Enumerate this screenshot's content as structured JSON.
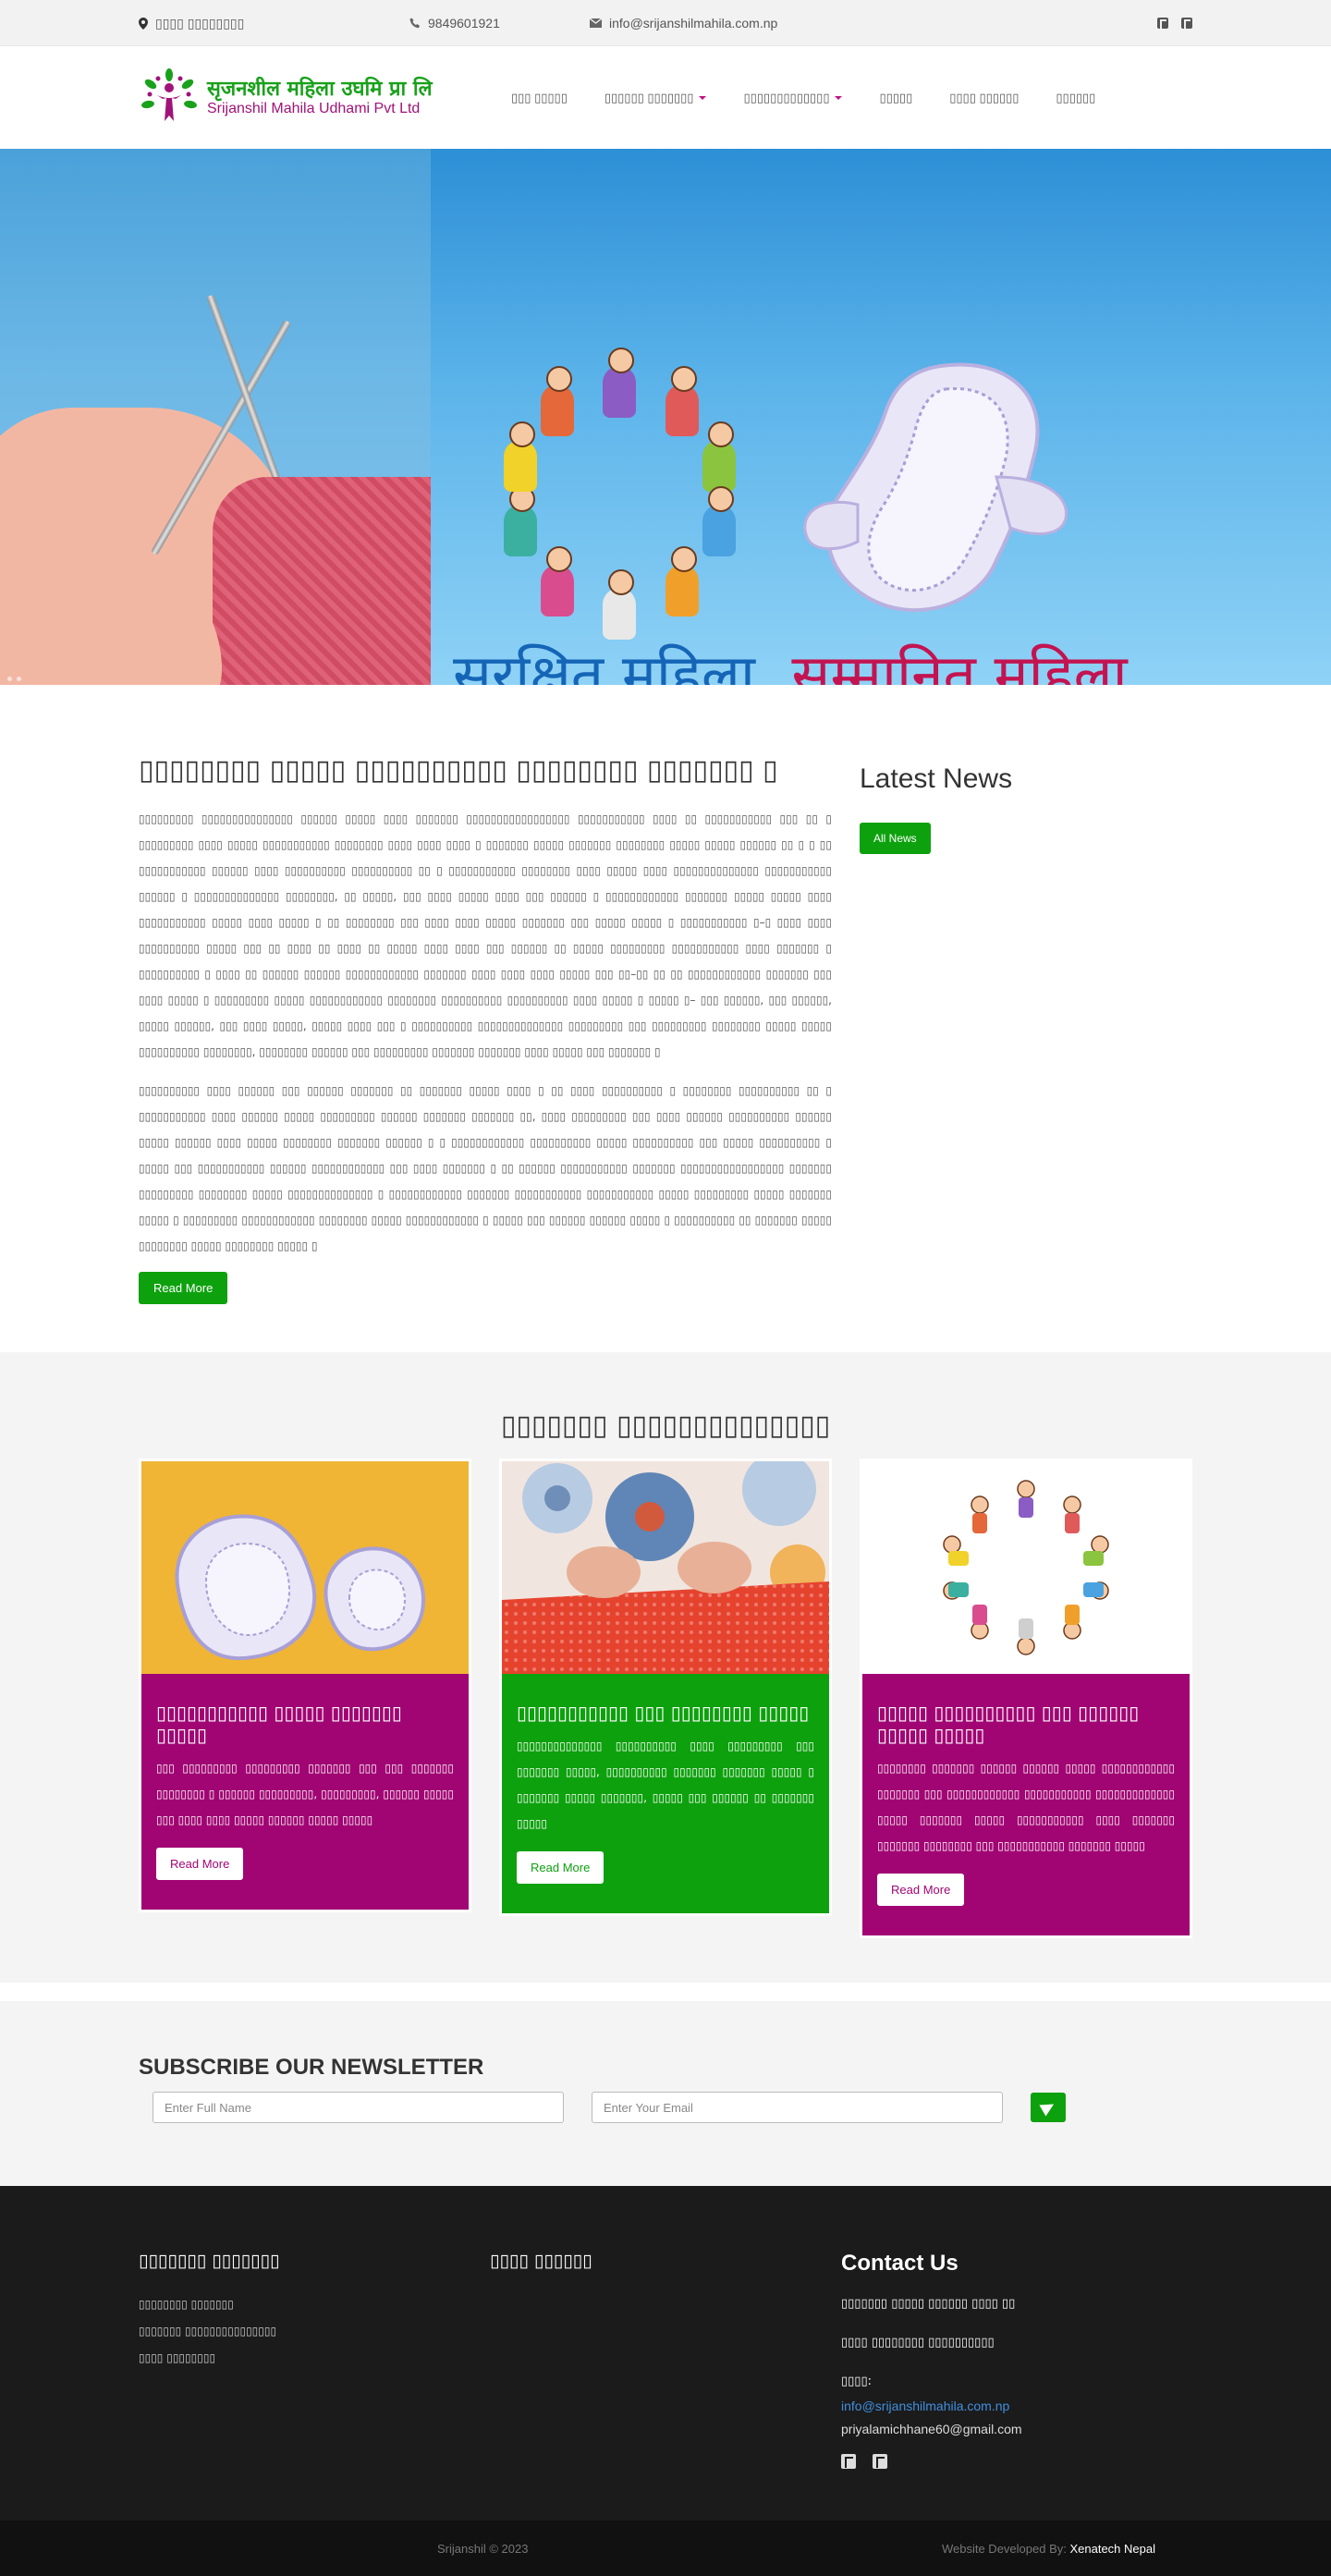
{
  "topbar": {
    "address": "▯▯▯▯ ▯▯▯▯▯▯▯▯",
    "phone": "9849601921",
    "email": "info@srijanshilmahila.com.np"
  },
  "brand": {
    "name_np": "सृजनशील महिला उघमि प्रा लि",
    "name_en": "Srijanshil Mahila Udhami Pvt Ltd"
  },
  "nav": {
    "items": [
      {
        "label": "▯▯▯ ▯▯▯▯▯"
      },
      {
        "label": "▯▯▯▯▯▯ ▯▯▯▯▯▯▯"
      },
      {
        "label": "▯▯▯▯▯▯▯▯▯▯▯▯▯"
      },
      {
        "label": "▯▯▯▯▯"
      },
      {
        "label": "▯▯▯▯ ▯▯▯▯▯▯"
      },
      {
        "label": "▯▯▯▯▯▯"
      }
    ]
  },
  "hero": {
    "tagline_part1": "सुरक्षित महिला,",
    "tagline_part2": "सम्मानित महिला"
  },
  "intro": {
    "heading": "▯▯▯▯▯▯▯▯ ▯▯▯▯▯ ▯▯▯▯▯▯▯▯▯▯ ▯▯▯▯▯▯▯▯ ▯▯▯▯▯▯▯ ▯",
    "paragraph1": "▯▯▯▯▯▯▯▯▯ ▯▯▯▯▯▯▯▯▯▯▯▯▯▯▯ ▯▯▯▯▯▯ ▯▯▯▯▯ ▯▯▯▯ ▯▯▯▯▯▯▯ ▯▯▯▯▯▯▯▯▯▯▯▯▯▯▯▯▯ ▯▯▯▯▯▯▯▯▯▯▯ ▯▯▯▯ ▯▯ ▯▯▯▯▯▯▯▯▯▯▯ ▯▯▯ ▯▯ ▯ ▯▯▯▯▯▯▯▯▯ ▯▯▯▯ ▯▯▯▯▯ ▯▯▯▯▯▯▯▯▯▯▯ ▯▯▯▯▯▯▯▯ ▯▯▯▯ ▯▯▯▯ ▯▯▯▯ ▯ ▯▯▯▯▯▯▯ ▯▯▯▯▯ ▯▯▯▯▯▯▯ ▯▯▯▯▯▯▯▯ ▯▯▯▯▯ ▯▯▯▯▯ ▯▯▯▯▯▯ ▯▯ ▯ ▯ ▯▯ ▯▯▯▯▯▯▯▯▯▯▯ ▯▯▯▯▯▯ ▯▯▯▯ ▯▯▯▯▯▯▯▯▯▯ ▯▯▯▯▯▯▯▯▯▯ ▯▯ ▯ ▯▯▯▯▯▯▯▯▯▯▯ ▯▯▯▯▯▯▯▯ ▯▯▯▯ ▯▯▯▯▯ ▯▯▯▯ ▯▯▯▯▯▯▯▯▯▯▯▯▯▯ ▯▯▯▯▯▯▯▯▯▯▯ ▯▯▯▯▯▯ ▯ ▯▯▯▯▯▯▯▯▯▯▯▯▯▯ ▯▯▯▯▯▯▯▯, ▯▯ ▯▯▯▯▯, ▯▯▯ ▯▯▯▯ ▯▯▯▯▯ ▯▯▯▯ ▯▯▯ ▯▯▯▯▯▯ ▯ ▯▯▯▯▯▯▯▯▯▯▯▯ ▯▯▯▯▯▯▯ ▯▯▯▯▯ ▯▯▯▯▯ ▯▯▯▯ ▯▯▯▯▯▯▯▯▯▯▯ ▯▯▯▯▯ ▯▯▯▯ ▯▯▯▯▯ ▯ ▯▯ ▯▯▯▯▯▯▯▯ ▯▯▯ ▯▯▯▯ ▯▯▯▯ ▯▯▯▯▯ ▯▯▯▯▯▯▯ ▯▯▯ ▯▯▯▯▯ ▯▯▯▯▯ ▯ ▯▯▯▯▯▯▯▯▯▯▯ ▯–▯ ▯▯▯▯ ▯▯▯▯ ▯▯▯▯▯▯▯▯▯▯ ▯▯▯▯▯ ▯▯▯ ▯▯ ▯▯▯▯ ▯▯ ▯▯▯▯ ▯▯ ▯▯▯▯▯ ▯▯▯▯ ▯▯▯▯ ▯▯▯ ▯▯▯▯▯▯ ▯▯ ▯▯▯▯▯ ▯▯▯▯▯▯▯▯▯ ▯▯▯▯▯▯▯▯▯▯▯ ▯▯▯▯ ▯▯▯▯▯▯▯ ▯ ▯▯▯▯▯▯▯▯▯▯ ▯ ▯▯▯▯ ▯▯ ▯▯▯▯▯▯ ▯▯▯▯▯▯ ▯▯▯▯▯▯▯▯▯▯▯▯ ▯▯▯▯▯▯▯ ▯▯▯▯ ▯▯▯▯ ▯▯▯▯ ▯▯▯▯▯ ▯▯▯ ▯▯–▯▯ ▯▯ ▯▯ ▯▯▯▯▯▯▯▯▯▯▯▯ ▯▯▯▯▯▯▯ ▯▯▯ ▯▯▯▯ ▯▯▯▯▯ ▯ ▯▯▯▯▯▯▯▯▯ ▯▯▯▯▯ ▯▯▯▯▯▯▯▯▯▯▯▯ ▯▯▯▯▯▯▯▯ ▯▯▯▯▯▯▯▯▯▯ ▯▯▯▯▯▯▯▯▯▯ ▯▯▯▯ ▯▯▯▯▯ ▯ ▯▯▯▯▯ ▯– ▯▯▯ ▯▯▯▯▯▯, ▯▯▯ ▯▯▯▯▯▯, ▯▯▯▯▯ ▯▯▯▯▯▯, ▯▯▯ ▯▯▯▯ ▯▯▯▯▯, ▯▯▯▯▯ ▯▯▯▯ ▯▯▯ ▯ ▯▯▯▯▯▯▯▯▯▯ ▯▯▯▯▯▯▯▯▯▯▯▯▯▯ ▯▯▯▯▯▯▯▯▯ ▯▯▯ ▯▯▯▯▯▯▯▯▯ ▯▯▯▯▯▯▯▯ ▯▯▯▯▯ ▯▯▯▯▯ ▯▯▯▯▯▯▯▯▯▯ ▯▯▯▯▯▯▯▯, ▯▯▯▯▯▯▯▯ ▯▯▯▯▯▯ ▯▯▯ ▯▯▯▯▯▯▯▯▯ ▯▯▯▯▯▯▯ ▯▯▯▯▯▯▯ ▯▯▯▯ ▯▯▯▯▯ ▯▯▯ ▯▯▯▯▯▯▯ ▯",
    "paragraph2": "▯▯▯▯▯▯▯▯▯▯ ▯▯▯▯ ▯▯▯▯▯▯ ▯▯▯ ▯▯▯▯▯▯ ▯▯▯▯▯▯▯ ▯▯ ▯▯▯▯▯▯▯ ▯▯▯▯▯ ▯▯▯▯ ▯ ▯▯ ▯▯▯▯ ▯▯▯▯▯▯▯▯▯▯ ▯ ▯▯▯▯▯▯▯▯ ▯▯▯▯▯▯▯▯▯▯ ▯▯ ▯ ▯▯▯▯▯▯▯▯▯▯▯ ▯▯▯▯ ▯▯▯▯▯▯ ▯▯▯▯▯ ▯▯▯▯▯▯▯▯▯ ▯▯▯▯▯▯ ▯▯▯▯▯▯▯ ▯▯▯▯▯▯▯ ▯▯, ▯▯▯▯ ▯▯▯▯▯▯▯▯▯ ▯▯▯ ▯▯▯▯ ▯▯▯▯▯▯ ▯▯▯▯▯▯▯▯▯▯ ▯▯▯▯▯▯ ▯▯▯▯▯ ▯▯▯▯▯▯ ▯▯▯▯ ▯▯▯▯▯ ▯▯▯▯▯▯▯▯ ▯▯▯▯▯▯▯ ▯▯▯▯▯▯ ▯ ▯ ▯▯▯▯▯▯▯▯▯▯▯▯ ▯▯▯▯▯▯▯▯▯▯ ▯▯▯▯▯ ▯▯▯▯▯▯▯▯▯▯ ▯▯▯ ▯▯▯▯▯ ▯▯▯▯▯▯▯▯▯▯ ▯ ▯▯▯▯▯ ▯▯▯ ▯▯▯▯▯▯▯▯▯▯▯ ▯▯▯▯▯▯ ▯▯▯▯▯▯▯▯▯▯▯▯ ▯▯▯ ▯▯▯▯ ▯▯▯▯▯▯▯ ▯ ▯▯ ▯▯▯▯▯▯ ▯▯▯▯▯▯▯▯▯▯▯ ▯▯▯▯▯▯▯ ▯▯▯▯▯▯▯▯▯▯▯▯▯▯▯▯▯ ▯▯▯▯▯▯▯ ▯▯▯▯▯▯▯▯▯ ▯▯▯▯▯▯▯▯ ▯▯▯▯▯ ▯▯▯▯▯▯▯▯▯▯▯▯▯▯ ▯ ▯▯▯▯▯▯▯▯▯▯▯▯ ▯▯▯▯▯▯▯ ▯▯▯▯▯▯▯▯▯▯▯ ▯▯▯▯▯▯▯▯▯▯▯ ▯▯▯▯▯ ▯▯▯▯▯▯▯▯▯ ▯▯▯▯▯ ▯▯▯▯▯▯▯ ▯▯▯▯▯ ▯ ▯▯▯▯▯▯▯▯▯ ▯▯▯▯▯▯▯▯▯▯▯▯ ▯▯▯▯▯▯▯▯ ▯▯▯▯▯ ▯▯▯▯▯▯▯▯▯▯▯▯ ▯ ▯▯▯▯▯ ▯▯▯ ▯▯▯▯▯▯ ▯▯▯▯▯▯ ▯▯▯▯▯ ▯ ▯▯▯▯▯▯▯▯▯▯ ▯▯ ▯▯▯▯▯▯▯ ▯▯▯▯▯ ▯▯▯▯▯▯▯▯ ▯▯▯▯▯ ▯▯▯▯▯▯▯▯ ▯▯▯▯▯ ▯",
    "read_more": "Read More"
  },
  "news": {
    "title": "Latest News",
    "all_news": "All News"
  },
  "services": {
    "title": "▯▯▯▯▯▯▯ ▯▯▯▯▯▯▯▯▯▯▯▯▯▯",
    "cards": [
      {
        "title": "▯▯▯▯▯▯▯▯▯▯▯ ▯▯▯▯▯ ▯▯▯▯▯▯▯ ▯▯▯▯▯",
        "text": "▯▯▯ ▯▯▯▯▯▯▯▯▯ ▯▯▯▯▯▯▯▯▯ ▯▯▯▯▯▯▯ ▯▯▯ ▯▯▯ ▯▯▯▯▯▯▯ ▯▯▯▯▯▯▯▯ ▯ ▯▯▯▯▯▯ ▯▯▯▯▯▯▯▯▯, ▯▯▯▯▯▯▯▯▯, ▯▯▯▯▯▯ ▯▯▯▯▯ ▯▯▯ ▯▯▯▯ ▯▯▯▯ ▯▯▯▯▯ ▯▯▯▯▯▯ ▯▯▯▯▯ ▯▯▯▯▯",
        "button": "Read More",
        "color": "#a10573"
      },
      {
        "title": "▯▯▯▯▯▯▯▯▯▯▯ ▯▯▯ ▯▯▯▯▯▯▯▯ ▯▯▯▯▯",
        "text": "▯▯▯▯▯▯▯▯▯▯▯▯▯▯ ▯▯▯▯▯▯▯▯▯▯ ▯▯▯▯ ▯▯▯▯▯▯▯▯▯ ▯▯▯ ▯▯▯▯▯▯▯ ▯▯▯▯▯, ▯▯▯▯▯▯▯▯▯▯ ▯▯▯▯▯▯▯ ▯▯▯▯▯▯▯ ▯▯▯▯▯ ▯ ▯▯▯▯▯▯▯ ▯▯▯▯▯ ▯▯▯▯▯▯▯, ▯▯▯▯▯ ▯▯▯ ▯▯▯▯▯▯ ▯▯ ▯▯▯▯▯▯▯ ▯▯▯▯▯",
        "button": "Read More",
        "color": "#0ea10e"
      },
      {
        "title": "▯▯▯▯▯ ▯▯▯▯▯▯▯▯▯▯ ▯▯▯ ▯▯▯▯▯▯ ▯▯▯▯▯ ▯▯▯▯▯",
        "text": "▯▯▯▯▯▯▯▯ ▯▯▯▯▯▯▯ ▯▯▯▯▯▯ ▯▯▯▯▯▯ ▯▯▯▯▯ ▯▯▯▯▯▯▯▯▯▯▯▯ ▯▯▯▯▯▯▯ ▯▯▯ ▯▯▯▯▯▯▯▯▯▯▯▯ ▯▯▯▯▯▯▯▯▯▯▯ ▯▯▯▯▯▯▯▯▯▯▯▯▯ ▯▯▯▯▯ ▯▯▯▯▯▯▯ ▯▯▯▯▯ ▯▯▯▯▯▯▯▯▯▯▯ ▯▯▯▯ ▯▯▯▯▯▯▯ ▯▯▯▯▯▯▯ ▯▯▯▯▯▯▯▯ ▯▯▯ ▯▯▯▯▯▯▯▯▯▯▯ ▯▯▯▯▯▯▯ ▯▯▯▯▯",
        "button": "Read More",
        "color": "#a10573"
      }
    ]
  },
  "newsletter": {
    "title": "SUBSCRIBE OUR NEWSLETTER",
    "name_placeholder": "Enter Full Name",
    "email_placeholder": "Enter Your Email"
  },
  "footer": {
    "col1_title": "▯▯▯▯▯▯▯ ▯▯▯▯▯▯▯",
    "col1_links": [
      "▯▯▯▯▯▯▯▯ ▯▯▯▯▯▯▯",
      "▯▯▯▯▯▯▯ ▯▯▯▯▯▯▯▯▯▯▯▯▯▯▯",
      "▯▯▯▯ ▯▯▯▯▯▯▯▯"
    ],
    "col2_title": "▯▯▯▯ ▯▯▯▯▯▯",
    "contact_title": "Contact Us",
    "contact_line1": "▯▯▯▯▯▯▯ ▯▯▯▯▯ ▯▯▯▯▯▯ ▯▯▯▯ ▯▯",
    "contact_line2": "▯▯▯▯ ▯▯▯▯▯▯▯▯ ▯▯▯▯▯▯▯▯▯▯",
    "contact_email_label": "▯▯▯▯:",
    "contact_email1": "info@srijanshilmahila.com.np",
    "contact_email2": "priyalamichhane60@gmail.com"
  },
  "bottom": {
    "copyright": "Srijanshil © 2023",
    "developed_by": "Website Developed By:",
    "developer": "Xenatech Nepal"
  },
  "colors": {
    "brand_green": "#0ea10e",
    "brand_magenta": "#a10573",
    "footer_bg": "#1b1b1b"
  },
  "icons": [
    "map-marker-icon",
    "phone-icon",
    "envelope-icon",
    "facebook-icon",
    "youtube-icon",
    "paper-plane-icon"
  ]
}
